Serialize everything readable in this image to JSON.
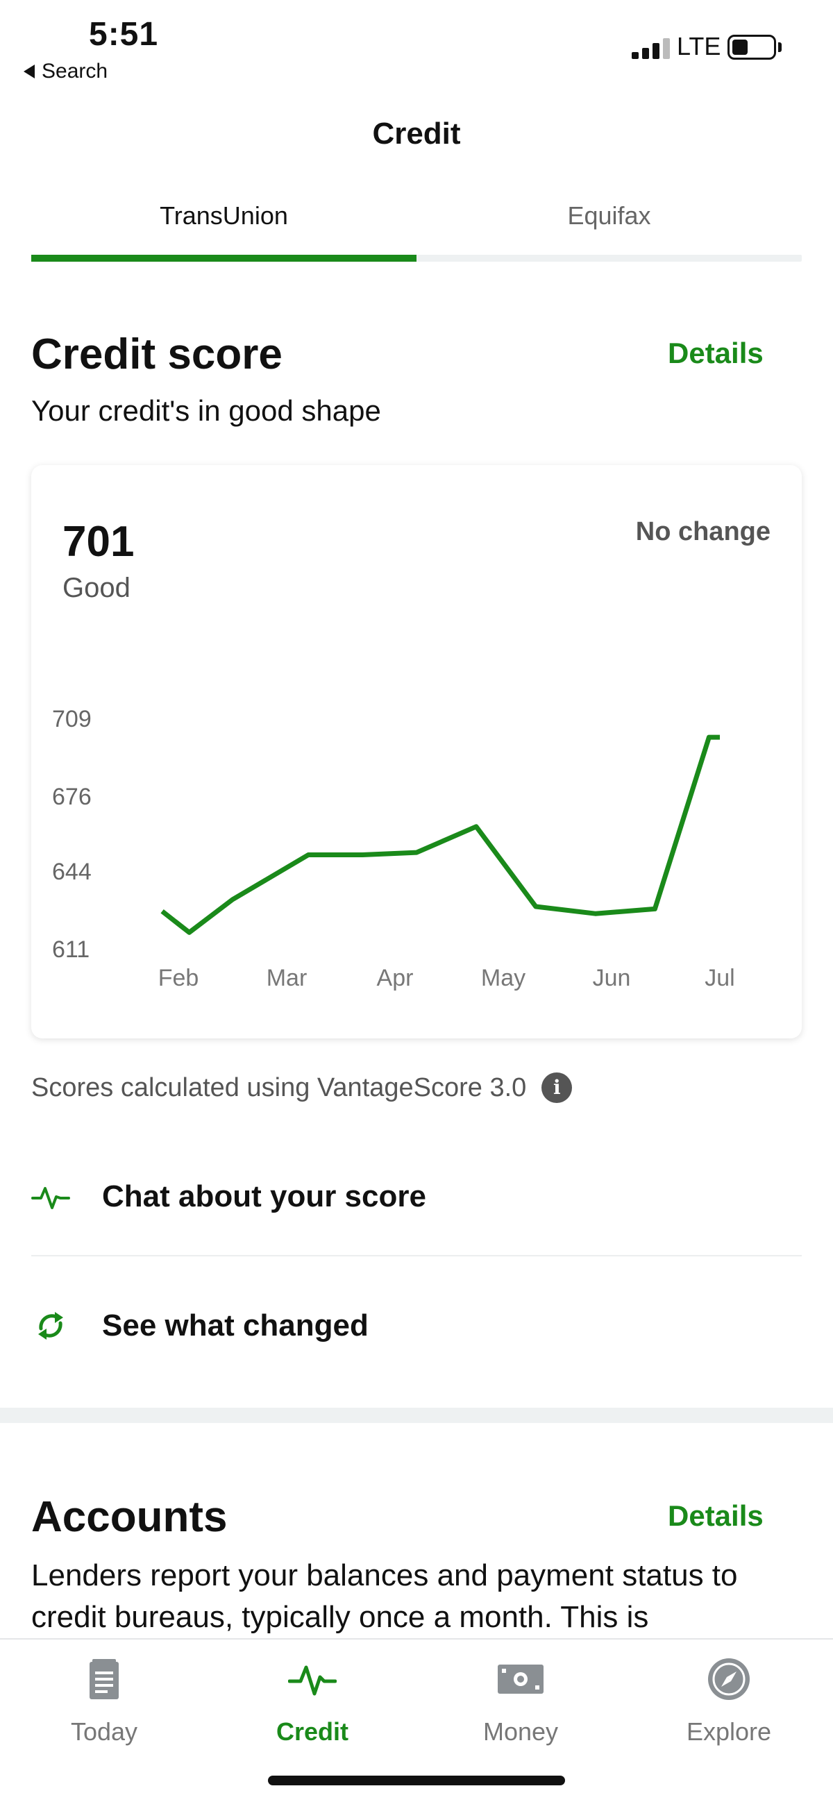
{
  "status_bar": {
    "time": "5:51",
    "back_label": "Search",
    "network": "LTE"
  },
  "header": {
    "title": "Credit"
  },
  "tabs": [
    {
      "label": "TransUnion",
      "active": true
    },
    {
      "label": "Equifax",
      "active": false
    }
  ],
  "credit_score": {
    "title": "Credit score",
    "details_label": "Details",
    "subtitle": "Your credit's in good shape",
    "score": "701",
    "rating": "Good",
    "change": "No change"
  },
  "chart_data": {
    "type": "line",
    "title": "",
    "xlabel": "",
    "ylabel": "",
    "y_ticks": [
      "709",
      "676",
      "644",
      "611"
    ],
    "x_ticks": [
      "Feb",
      "Mar",
      "Apr",
      "May",
      "Jun",
      "Jul"
    ],
    "ylim": [
      611,
      709
    ],
    "grid": false,
    "color": "#1a8a1a",
    "series": [
      {
        "points": [
          {
            "x": 0.85,
            "y": 627
          },
          {
            "x": 1.1,
            "y": 618
          },
          {
            "x": 1.5,
            "y": 632
          },
          {
            "x": 2.2,
            "y": 651
          },
          {
            "x": 2.7,
            "y": 651
          },
          {
            "x": 3.2,
            "y": 652
          },
          {
            "x": 3.75,
            "y": 663
          },
          {
            "x": 4.3,
            "y": 629
          },
          {
            "x": 4.85,
            "y": 626
          },
          {
            "x": 5.4,
            "y": 628
          },
          {
            "x": 5.9,
            "y": 701
          },
          {
            "x": 6.0,
            "y": 701
          }
        ]
      }
    ]
  },
  "footnote": {
    "text": "Scores calculated using VantageScore 3.0",
    "info_icon": "info-icon"
  },
  "actions": [
    {
      "label": "Chat about your score",
      "icon": "pulse-icon"
    },
    {
      "label": "See what changed",
      "icon": "refresh-icon"
    }
  ],
  "accounts": {
    "title": "Accounts",
    "details_label": "Details",
    "text": "Lenders report your balances and payment status to credit bureaus, typically once a month. This is"
  },
  "bottom_nav": [
    {
      "label": "Today",
      "icon": "document-icon",
      "active": false
    },
    {
      "label": "Credit",
      "icon": "pulse-icon",
      "active": true
    },
    {
      "label": "Money",
      "icon": "cash-icon",
      "active": false
    },
    {
      "label": "Explore",
      "icon": "compass-icon",
      "active": false
    }
  ],
  "colors": {
    "accent": "#1a8a1a",
    "muted": "#777777"
  }
}
